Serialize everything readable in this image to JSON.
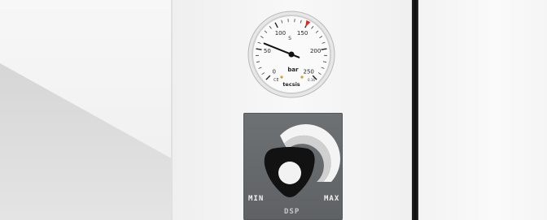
{
  "gauge": {
    "unit": "bar",
    "scale": [
      "0",
      "50",
      "100",
      "150",
      "200",
      "250"
    ],
    "brand": "tecsis",
    "fill_mark": "S",
    "value": 62,
    "min": 0,
    "max": 250,
    "accent": "#d9281e",
    "small_text": "0.16"
  },
  "regulator": {
    "min_label": "MIN",
    "max_label": "MAX",
    "center_label": "DSP",
    "plate_color": "#656869"
  }
}
